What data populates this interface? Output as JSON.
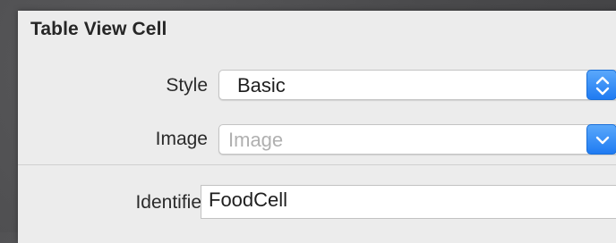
{
  "section": {
    "title": "Table View Cell"
  },
  "style_row": {
    "label": "Style",
    "value": "Basic"
  },
  "image_row": {
    "label": "Image",
    "placeholder": "Image"
  },
  "identifier_row": {
    "label": "Identifier",
    "value": "FoodCell"
  },
  "icons": {
    "style_stepper": "up-down-chevron-icon",
    "image_dropdown": "chevron-down-icon"
  },
  "colors": {
    "accent": "#1f7bf2",
    "panel": "#ececec",
    "backdrop": "#4e4e50"
  }
}
